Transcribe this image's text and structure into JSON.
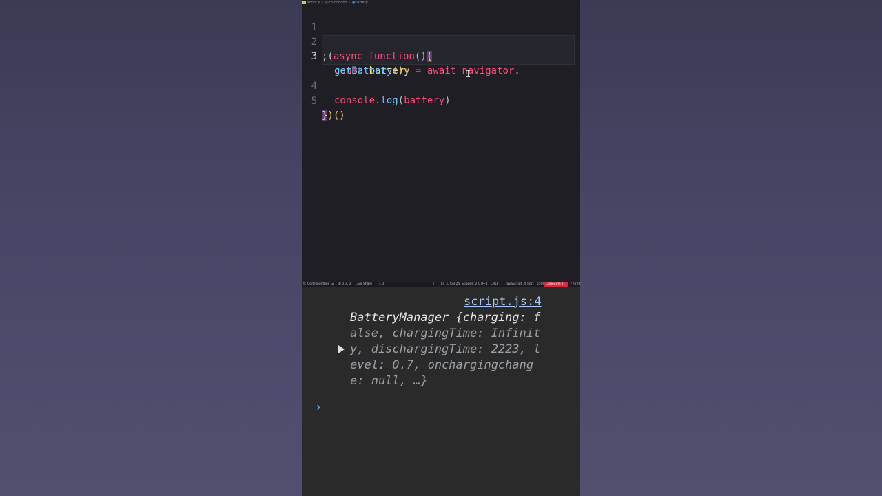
{
  "breadcrumb": {
    "file": "script.js",
    "function": "<function>",
    "symbol": "battery"
  },
  "editor": {
    "lines": [
      {
        "num": "1"
      },
      {
        "num": "2",
        "t": [
          ";(",
          "async",
          " ",
          "function",
          "()",
          "{"
        ]
      },
      {
        "num": "3",
        "t": [
          "const",
          " ",
          "battery",
          " = ",
          "await",
          " ",
          "navigator",
          "."
        ]
      },
      {
        "wrap": [
          "getBattery",
          "();"
        ]
      },
      {
        "num": "4",
        "t": [
          "console",
          ".",
          "log",
          "(",
          "battery",
          ")"
        ]
      },
      {
        "num": "5",
        "t": [
          "}",
          ")()"
        ]
      }
    ]
  },
  "statusbar": {
    "codetogether": "CodeTogether",
    "problems": "⊗ 0 ⚠ 0",
    "liveshare": "Live Share",
    "ports": "⑃ 0",
    "position": "Ln 3, Col 25",
    "spaces": "Spaces: 2",
    "encoding": "UTF-8",
    "eol": "CRLF",
    "language": "{} JavaScript",
    "port": "⊘ Port : 5500",
    "codeium": "Codeium: {.}",
    "prettier": "✓ Prettier"
  },
  "console": {
    "source_link": "script.js:4",
    "log_lines": [
      "BatteryManager {charging: f",
      "alse, chargingTime: Infinit",
      "y, dischargingTime: 2223, l",
      "evel: 0.7, onchargingchang",
      "e: null, …}"
    ],
    "prompt": "›"
  },
  "colors": {
    "editor_bg": "#1e1e24",
    "console_bg": "#2a2a2b",
    "keyword_pink": "#ff4b7a",
    "identifier_yellow": "#ffd866",
    "function_blue": "#6ec2f2",
    "number_purple": "#9e8cff",
    "codeium_red": "#d7263d"
  }
}
